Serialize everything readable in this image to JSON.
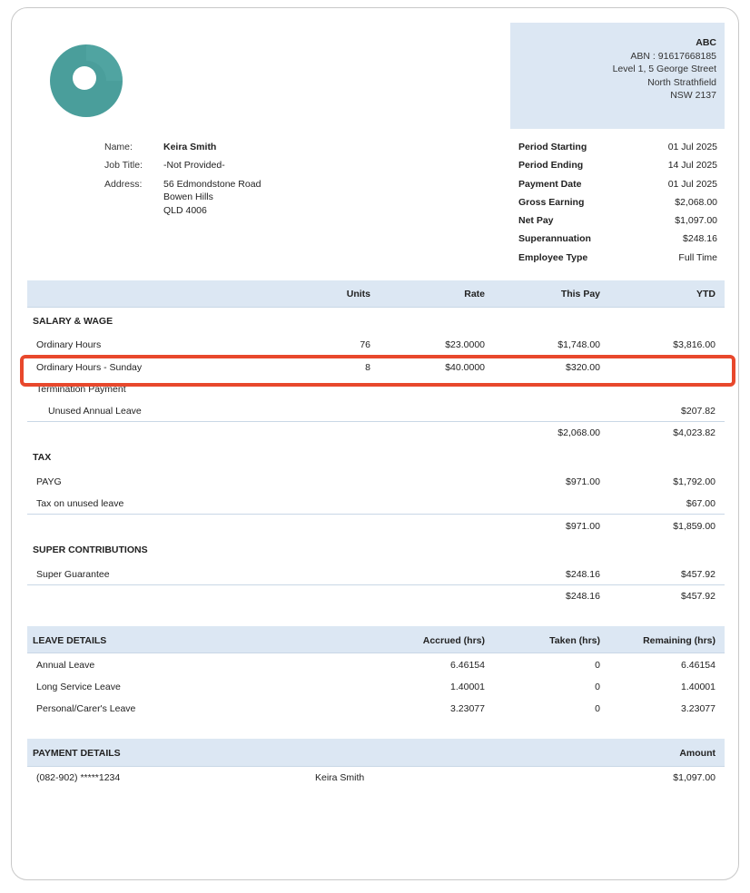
{
  "company": {
    "name": "ABC",
    "abn": "ABN : 91617668185",
    "address1": "Level 1, 5 George Street",
    "address2": "North Strathfield",
    "address3": "NSW 2137"
  },
  "employee": {
    "name_label": "Name:",
    "name": "Keira Smith",
    "job_label": "Job Title:",
    "job": "-Not Provided-",
    "address_label": "Address:",
    "address1": "56 Edmondstone Road",
    "address2": "Bowen Hills",
    "address3": "QLD 4006"
  },
  "period": [
    {
      "label": "Period Starting",
      "value": "01 Jul 2025"
    },
    {
      "label": "Period Ending",
      "value": "14 Jul 2025"
    },
    {
      "label": "Payment Date",
      "value": "01 Jul 2025"
    },
    {
      "label": "Gross Earning",
      "value": "$2,068.00"
    },
    {
      "label": "Net Pay",
      "value": "$1,097.00"
    },
    {
      "label": "Superannuation",
      "value": "$248.16"
    },
    {
      "label": "Employee Type",
      "value": "Full Time"
    }
  ],
  "earnings_header": {
    "units": "Units",
    "rate": "Rate",
    "this_pay": "This Pay",
    "ytd": "YTD"
  },
  "salary": {
    "title": "SALARY & WAGE",
    "rows": [
      {
        "name": "Ordinary Hours",
        "units": "76",
        "rate": "$23.0000",
        "this_pay": "$1,748.00",
        "ytd": "$3,816.00"
      },
      {
        "name": "Ordinary Hours - Sunday",
        "units": "8",
        "rate": "$40.0000",
        "this_pay": "$320.00",
        "ytd": ""
      }
    ],
    "termination": "Termination Payment",
    "unused": {
      "name": "Unused Annual Leave",
      "ytd": "$207.82"
    },
    "total": {
      "this_pay": "$2,068.00",
      "ytd": "$4,023.82"
    }
  },
  "tax": {
    "title": "TAX",
    "rows": [
      {
        "name": "PAYG",
        "this_pay": "$971.00",
        "ytd": "$1,792.00"
      },
      {
        "name": "Tax on unused leave",
        "this_pay": "",
        "ytd": "$67.00"
      }
    ],
    "total": {
      "this_pay": "$971.00",
      "ytd": "$1,859.00"
    }
  },
  "super": {
    "title": "SUPER CONTRIBUTIONS",
    "rows": [
      {
        "name": "Super Guarantee",
        "this_pay": "$248.16",
        "ytd": "$457.92"
      }
    ],
    "total": {
      "this_pay": "$248.16",
      "ytd": "$457.92"
    }
  },
  "leave": {
    "title": "LEAVE DETAILS",
    "accrued": "Accrued (hrs)",
    "taken": "Taken (hrs)",
    "remaining": "Remaining (hrs)",
    "rows": [
      {
        "name": "Annual Leave",
        "accrued": "6.46154",
        "taken": "0",
        "remaining": "6.46154"
      },
      {
        "name": "Long Service Leave",
        "accrued": "1.40001",
        "taken": "0",
        "remaining": "1.40001"
      },
      {
        "name": "Personal/Carer's Leave",
        "accrued": "3.23077",
        "taken": "0",
        "remaining": "3.23077"
      }
    ]
  },
  "payment": {
    "title": "PAYMENT DETAILS",
    "amount_label": "Amount",
    "account": "(082-902) *****1234",
    "payee": "Keira Smith",
    "amount": "$1,097.00"
  },
  "colors": {
    "accent": "#4a9e9b",
    "header_bg": "#dce7f3",
    "highlight": "#e8482c"
  }
}
